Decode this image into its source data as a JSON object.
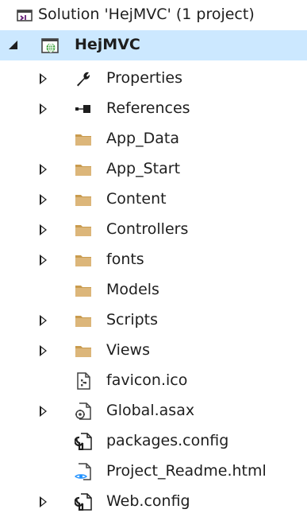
{
  "solution_explorer": {
    "solution": {
      "label": "Solution 'HejMVC' (1 project)",
      "icon": "solution-icon"
    },
    "project": {
      "label": "HejMVC",
      "icon": "web-project-icon",
      "expanded": true
    },
    "items": [
      {
        "label": "Properties",
        "icon": "wrench-icon",
        "expandable": true
      },
      {
        "label": "References",
        "icon": "references-icon",
        "expandable": true
      },
      {
        "label": "App_Data",
        "icon": "folder-icon",
        "expandable": false
      },
      {
        "label": "App_Start",
        "icon": "folder-icon",
        "expandable": true
      },
      {
        "label": "Content",
        "icon": "folder-icon",
        "expandable": true
      },
      {
        "label": "Controllers",
        "icon": "folder-icon",
        "expandable": true
      },
      {
        "label": "fonts",
        "icon": "folder-icon",
        "expandable": true
      },
      {
        "label": "Models",
        "icon": "folder-icon",
        "expandable": false
      },
      {
        "label": "Scripts",
        "icon": "folder-icon",
        "expandable": true
      },
      {
        "label": "Views",
        "icon": "folder-icon",
        "expandable": true
      },
      {
        "label": "favicon.ico",
        "icon": "image-file-icon",
        "expandable": false
      },
      {
        "label": "Global.asax",
        "icon": "global-asax-icon",
        "expandable": true
      },
      {
        "label": "packages.config",
        "icon": "config-file-icon",
        "expandable": false
      },
      {
        "label": "Project_Readme.html",
        "icon": "html-file-icon",
        "expandable": false
      },
      {
        "label": "Web.config",
        "icon": "config-file-icon",
        "expandable": true
      }
    ],
    "colors": {
      "selection": "#cce8ff",
      "folder": "#dcb67a",
      "folder_tab": "#c99b4e",
      "globe": "#3ba33b",
      "text": "#1e1e1e"
    }
  }
}
